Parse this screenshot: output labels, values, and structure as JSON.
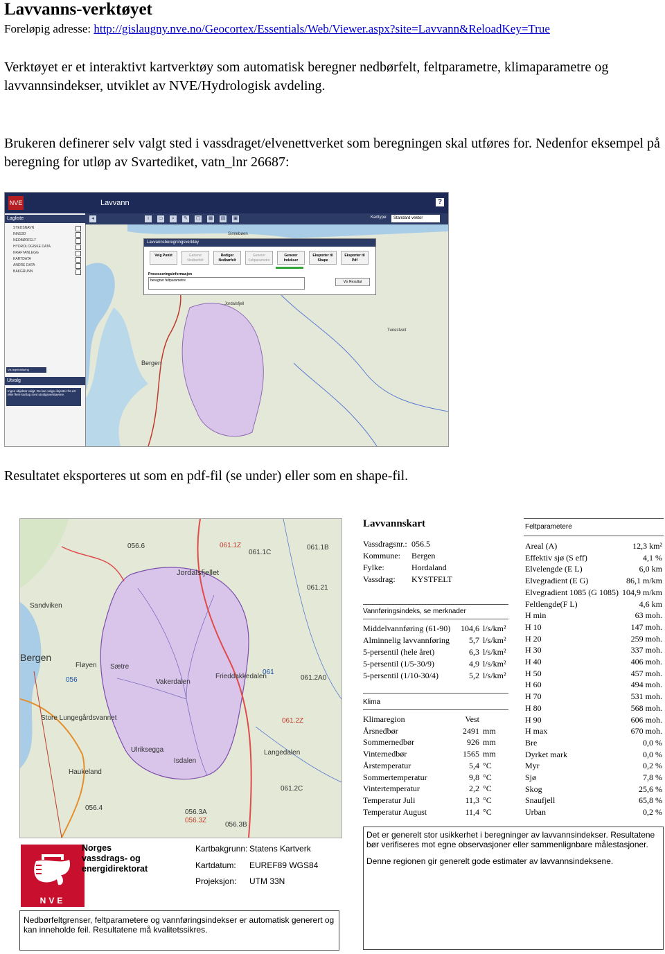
{
  "heading": "Lavvanns-verktøyet",
  "address": {
    "label": "Foreløpig adresse:",
    "url": "http://gislaugny.nve.no/Geocortex/Essentials/Web/Viewer.aspx?site=Lavvann&ReloadKey=True"
  },
  "paragraphs": {
    "p1": "Verktøyet er et interaktivt kartverktøy som automatisk beregner nedbørfelt, feltparametre, klimaparametre og lavvannsindekser, utviklet av NVE/Hydrologisk avdeling.",
    "p2": "Brukeren definerer selv valgt sted i vassdraget/elvenettverket som beregningen skal utføres for. Nedenfor eksempel på beregning for utløp av Svartediket, vatn_lnr 26687:",
    "p3": "Resultatet eksporteres ut som en pdf-fil (se under) eller som en shape-fil."
  },
  "app": {
    "title": "Lavvann",
    "logo": "NVE",
    "help": "?",
    "layer_list_title": "Lagliste",
    "layers": [
      "STEDSNAVN",
      "INNS3D",
      "NEDBØRFELT",
      "HYDROLOGISKE DATA",
      "KRAFTANLEGG",
      "KARTDATA",
      "ANDRE DATA",
      "BAKGRUNN"
    ],
    "legend_button": "Vis tegnforklaring",
    "selection_title": "Utvalg",
    "selection_text": "Ingen objekter valgt. Du kan velge objekter fra ett eller flere kartlag med utvalgsverktøyene.",
    "karttype_label": "Karttype:",
    "karttype_value": "Standard vektor",
    "dialog_title": "Lavvannsberegningsverktøy",
    "dialog_buttons": [
      "Velg Punkt",
      "Generer Nedbørfelt",
      "Rediger Nedbørfelt",
      "Generer Feltparametre",
      "Generer Indekser",
      "Eksporter til Shape",
      "Eksporter til Pdf"
    ],
    "processing_label": "Prosesseringsinformasjon",
    "processing_text": "beregner feltparametre",
    "vis_resultat": "Vis Resultat",
    "map_labels": [
      "Bergen",
      "Simlebøen",
      "Jordalsfjell",
      "Tunestveit"
    ]
  },
  "pdf_map": {
    "labels": [
      {
        "text": "056.6",
        "cls": ""
      },
      {
        "text": "061.1Z",
        "cls": "red"
      },
      {
        "text": "061.1C",
        "cls": ""
      },
      {
        "text": "061.1B",
        "cls": ""
      },
      {
        "text": "Jordalsfjellet",
        "cls": ""
      },
      {
        "text": "061.21",
        "cls": ""
      },
      {
        "text": "Sandviken",
        "cls": ""
      },
      {
        "text": "Bergen",
        "cls": "big"
      },
      {
        "text": "Fløyen",
        "cls": ""
      },
      {
        "text": "Sætre",
        "cls": ""
      },
      {
        "text": "Vakerdalen",
        "cls": ""
      },
      {
        "text": "056",
        "cls": "blue"
      },
      {
        "text": "061",
        "cls": "blue"
      },
      {
        "text": "Frieddakkedalen",
        "cls": ""
      },
      {
        "text": "061.2A0",
        "cls": ""
      },
      {
        "text": "Store Lungegårdsvannet",
        "cls": ""
      },
      {
        "text": "Ulriksegga",
        "cls": ""
      },
      {
        "text": "Isdalen",
        "cls": ""
      },
      {
        "text": "061.2Z",
        "cls": "red"
      },
      {
        "text": "Langedalen",
        "cls": ""
      },
      {
        "text": "Haukeland",
        "cls": ""
      },
      {
        "text": "061.2C",
        "cls": ""
      },
      {
        "text": "056.4",
        "cls": ""
      },
      {
        "text": "056.3A",
        "cls": ""
      },
      {
        "text": "056.3Z",
        "cls": "red"
      },
      {
        "text": "056.3B",
        "cls": ""
      }
    ]
  },
  "pdf_footer": {
    "org_lines": [
      "Norges",
      "vassdrags- og",
      "energidirektorat"
    ],
    "logo_text": "NVE",
    "rows": [
      {
        "label": "Kartbakgrunn:",
        "value": "Statens Kartverk"
      },
      {
        "label": "Kartdatum:",
        "value": "EUREF89 WGS84"
      },
      {
        "label": "Projeksjon:",
        "value": "UTM 33N"
      }
    ],
    "disclaimer": "Nedbørfeltgrenser, feltparametere og vannføringsindekser er automatisk generert og kan inneholde feil. Resultatene må kvalitetssikres."
  },
  "lavvannskart": {
    "title": "Lavvannskart",
    "info": [
      {
        "label": "Vassdragsnr.:",
        "value": "056.5"
      },
      {
        "label": "Kommune:",
        "value": "Bergen"
      },
      {
        "label": "Fylke:",
        "value": "Hordaland"
      },
      {
        "label": "Vassdrag:",
        "value": "KYSTFELT"
      }
    ],
    "vf_title": "Vannføringsindeks, se merknader",
    "vf_rows": [
      {
        "label": "Middelvannføring (61-90)",
        "value": "104,6",
        "unit": "l/s/km²"
      },
      {
        "label": "Alminnelig lavvannføring",
        "value": "5,7",
        "unit": "l/s/km²"
      },
      {
        "label": "5-persentil (hele året)",
        "value": "6,3",
        "unit": "l/s/km²"
      },
      {
        "label": "5-persentil (1/5-30/9)",
        "value": "4,9",
        "unit": "l/s/km²"
      },
      {
        "label": "5-persentil (1/10-30/4)",
        "value": "5,2",
        "unit": "l/s/km²"
      }
    ],
    "klima_title": "Klima",
    "klima_rows": [
      {
        "label": "Klimaregion",
        "value": "Vest",
        "unit": ""
      },
      {
        "label": "Årsnedbør",
        "value": "2491",
        "unit": "mm"
      },
      {
        "label": "Sommernedbør",
        "value": "926",
        "unit": "mm"
      },
      {
        "label": "Vinternedbør",
        "value": "1565",
        "unit": "mm"
      },
      {
        "label": "Årstemperatur",
        "value": "5,4",
        "unit": "°C"
      },
      {
        "label": "Sommertemperatur",
        "value": "9,8",
        "unit": "°C"
      },
      {
        "label": "Vintertemperatur",
        "value": "2,2",
        "unit": "°C"
      },
      {
        "label": "Temperatur Juli",
        "value": "11,3",
        "unit": "°C"
      },
      {
        "label": "Temperatur August",
        "value": "11,4",
        "unit": "°C"
      }
    ]
  },
  "feltparametere": {
    "title": "Feltparametere",
    "rows": [
      {
        "label": "Areal (A)",
        "value": "12,3 km²"
      },
      {
        "label": "Effektiv sjø (S eff)",
        "value": "4,1 %"
      },
      {
        "label": "Elvelengde (E L)",
        "value": "6,0 km"
      },
      {
        "label": "Elvegradient (E G)",
        "value": "86,1 m/km"
      },
      {
        "label": "Elvegradient 1085 (G 1085)",
        "value": "104,9 m/km"
      },
      {
        "label": "Feltlengde(F L)",
        "value": "4,6 km"
      },
      {
        "label": "H min",
        "value": "63 moh."
      },
      {
        "label": "H 10",
        "value": "147 moh."
      },
      {
        "label": "H 20",
        "value": "259 moh."
      },
      {
        "label": "H 30",
        "value": "337 moh."
      },
      {
        "label": "H 40",
        "value": "406 moh."
      },
      {
        "label": "H 50",
        "value": "457 moh."
      },
      {
        "label": "H 60",
        "value": "494 moh."
      },
      {
        "label": "H 70",
        "value": "531 moh."
      },
      {
        "label": "H 80",
        "value": "568 moh."
      },
      {
        "label": "H 90",
        "value": "606 moh."
      },
      {
        "label": "H max",
        "value": "670 moh."
      },
      {
        "label": "Bre",
        "value": "0,0 %"
      },
      {
        "label": "Dyrket mark",
        "value": "0,0 %"
      },
      {
        "label": "Myr",
        "value": "0,2 %"
      },
      {
        "label": "Sjø",
        "value": "7,8 %"
      },
      {
        "label": "Skog",
        "value": "25,6 %"
      },
      {
        "label": "Snaufjell",
        "value": "65,8 %"
      },
      {
        "label": "Urban",
        "value": "0,2 %"
      }
    ]
  },
  "notes": {
    "n1": "Det er generelt stor usikkerhet i beregninger av lavvannsindekser. Resultatene bør verifiseres mot egne observasjoner eller sammenlignbare målestasjoner.",
    "n2": "Denne regionen gir generelt gode estimater av lavvannsindeksene."
  }
}
